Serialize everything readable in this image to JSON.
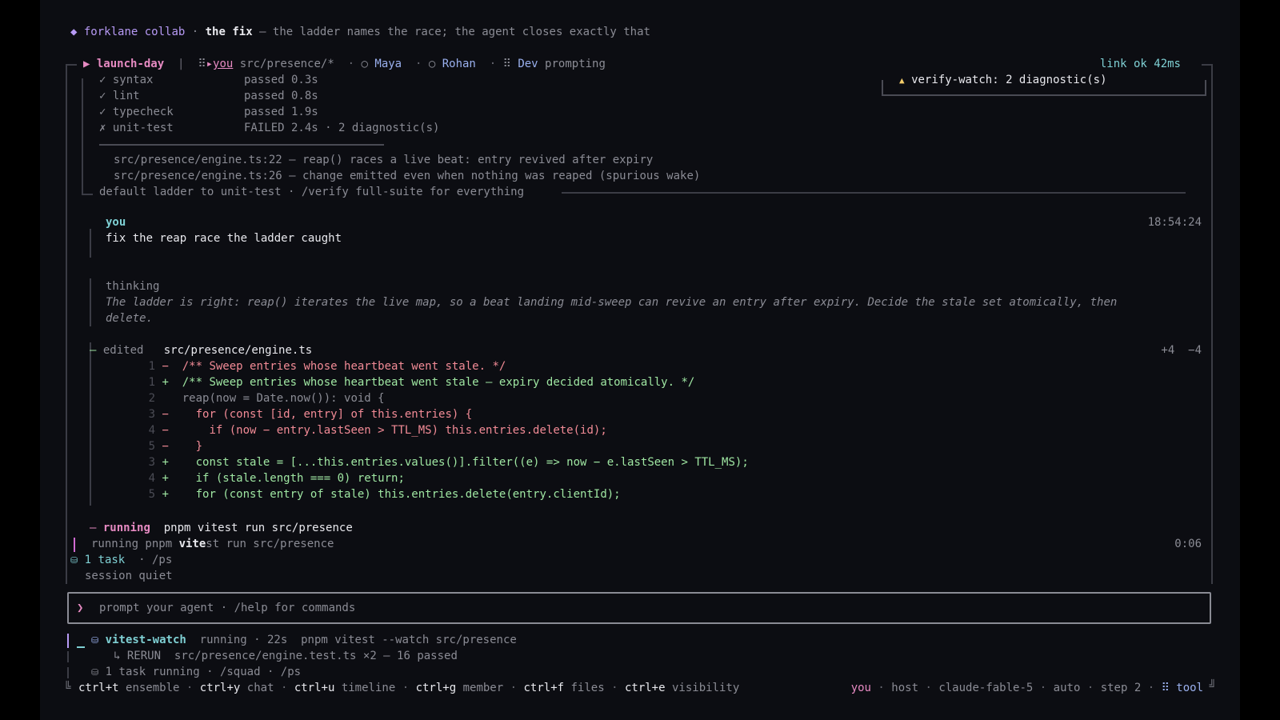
{
  "header": {
    "diamond": "◆",
    "app": "forklane collab",
    "sep": "·",
    "title": "the fix",
    "tagline": "— the ladder names the race; the agent closes exactly that"
  },
  "tabbar": {
    "arrow": "▶",
    "branch": "launch-day",
    "divider": "|",
    "you_glyph": "⠿",
    "you_prefix": "▸",
    "you": "you",
    "path": "src/presence/*",
    "members": [
      {
        "glyph": "○",
        "name": "Maya"
      },
      {
        "glyph": "○",
        "name": "Rohan"
      }
    ],
    "dev_glyph": "⠿",
    "dev": "Dev",
    "dev_status": "prompting",
    "link": "link ok 42ms"
  },
  "alert": {
    "icon": "▲",
    "text": "verify-watch: 2 diagnostic(s)"
  },
  "checks": [
    {
      "mark": "✓",
      "name": "syntax",
      "result": "passed 0.3s",
      "failed": false
    },
    {
      "mark": "✓",
      "name": "lint",
      "result": "passed 0.8s",
      "failed": false
    },
    {
      "mark": "✓",
      "name": "typecheck",
      "result": "passed 1.9s",
      "failed": false
    },
    {
      "mark": "✗",
      "name": "unit-test",
      "result": "FAILED 2.4s · 2 diagnostic(s)",
      "failed": true
    }
  ],
  "diagnostics": [
    "src/presence/engine.ts:22 — reap() races a live beat: entry revived after expiry",
    "src/presence/engine.ts:26 — change emitted even when nothing was reaped (spurious wake)"
  ],
  "ladder_footer": "default ladder to unit-test · /verify full-suite for everything",
  "message": {
    "author": "you",
    "time": "18:54:24",
    "text": "fix the reap race the ladder caught"
  },
  "thinking": {
    "label": "thinking",
    "line1": "The ladder is right: reap() iterates the live map, so a beat landing mid-sweep can revive an entry after expiry. Decide the stale set atomically, then",
    "line2": "delete."
  },
  "edit": {
    "dash": "—",
    "label": "edited",
    "file": "src/presence/engine.ts",
    "added": "+4",
    "removed": "−4",
    "lines": [
      {
        "n": "1",
        "s": "−",
        "code": "/** Sweep entries whose heartbeat went stale. */",
        "kind": "del"
      },
      {
        "n": "1",
        "s": "+",
        "code": "/** Sweep entries whose heartbeat went stale — expiry decided atomically. */",
        "kind": "add"
      },
      {
        "n": "2",
        "s": " ",
        "code": "reap(now = Date.now()): void {",
        "kind": "ctx"
      },
      {
        "n": "3",
        "s": "−",
        "code": "  for (const [id, entry] of this.entries) {",
        "kind": "del"
      },
      {
        "n": "4",
        "s": "−",
        "code": "    if (now − entry.lastSeen > TTL_MS) this.entries.delete(id);",
        "kind": "del"
      },
      {
        "n": "5",
        "s": "−",
        "code": "  }",
        "kind": "del"
      },
      {
        "n": "3",
        "s": "+",
        "code": "  const stale = [...this.entries.values()].filter((e) => now − e.lastSeen > TTL_MS);",
        "kind": "add"
      },
      {
        "n": "4",
        "s": "+",
        "code": "  if (stale.length === 0) return;",
        "kind": "add"
      },
      {
        "n": "5",
        "s": "+",
        "code": "  for (const entry of stale) this.entries.delete(entry.clientId);",
        "kind": "add"
      }
    ]
  },
  "run": {
    "dash": "—",
    "label": "running",
    "cmd": "pnpm vitest run src/presence",
    "status_pre": "running pnpm ",
    "status_hl": "vite",
    "status_post": "st run src/presence",
    "elapsed": "0:06"
  },
  "tasks": {
    "icon": "⛁",
    "count": "1 task",
    "sep": "·",
    "cmd": "/ps"
  },
  "session": "session quiet",
  "prompt": {
    "caret": "❯",
    "placeholder": "prompt your agent · /help for commands"
  },
  "watch": {
    "icon": "⛁",
    "name": "vitest-watch",
    "status": "running · 22s  pnpm vitest --watch src/presence",
    "rerun_arrow": "↳",
    "rerun_label": "RERUN",
    "rerun_text": "src/presence/engine.test.ts ×2 — 16 passed",
    "task_icon": "⛁",
    "task_text": "1 task running · /squad · /ps"
  },
  "shortcuts": [
    {
      "key": "ctrl+t",
      "label": "ensemble"
    },
    {
      "key": "ctrl+y",
      "label": "chat"
    },
    {
      "key": "ctrl+u",
      "label": "timeline"
    },
    {
      "key": "ctrl+g",
      "label": "member"
    },
    {
      "key": "ctrl+f",
      "label": "files"
    },
    {
      "key": "ctrl+e",
      "label": "visibility"
    }
  ],
  "statusbar": {
    "you": "you",
    "host": "host",
    "model": "claude-fable-5",
    "mode": "auto",
    "step": "step 2",
    "glyph": "⠿",
    "tool": "tool"
  },
  "colors": {
    "background": "#0c0d12",
    "accent_purple": "#b79af5",
    "accent_blue": "#9ab0ee",
    "add_green": "#9fe6a2",
    "del_red": "#f28b96",
    "warn_yellow": "#f4cd6a"
  }
}
